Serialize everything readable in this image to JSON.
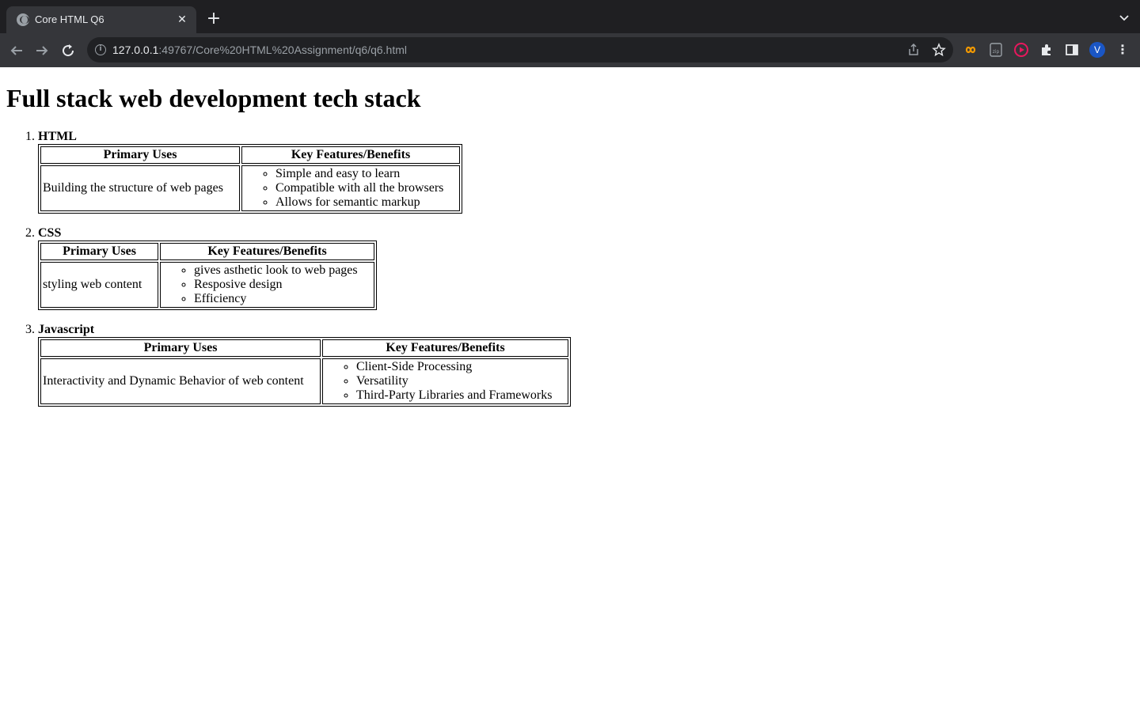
{
  "browser": {
    "tab_title": "Core HTML Q6",
    "url_host": "127.0.0.1",
    "url_rest": ":49767/Core%20HTML%20Assignment/q6/q6.html",
    "avatar_letter": "V"
  },
  "page": {
    "heading": "Full stack web development tech stack",
    "col_primary": "Primary Uses",
    "col_features": "Key Features/Benefits",
    "items": [
      {
        "name": "HTML",
        "primary_use": "Building the structure of web pages",
        "features": [
          "Simple and easy to learn",
          "Compatible with all the browsers",
          "Allows for semantic markup"
        ]
      },
      {
        "name": "CSS",
        "primary_use": "styling web content",
        "features": [
          "gives asthetic look to web pages",
          "Resposive design",
          "Efficiency"
        ]
      },
      {
        "name": "Javascript",
        "primary_use": "Interactivity and Dynamic Behavior of web content",
        "features": [
          "Client-Side Processing",
          "Versatility",
          "Third-Party Libraries and Frameworks"
        ]
      }
    ]
  }
}
